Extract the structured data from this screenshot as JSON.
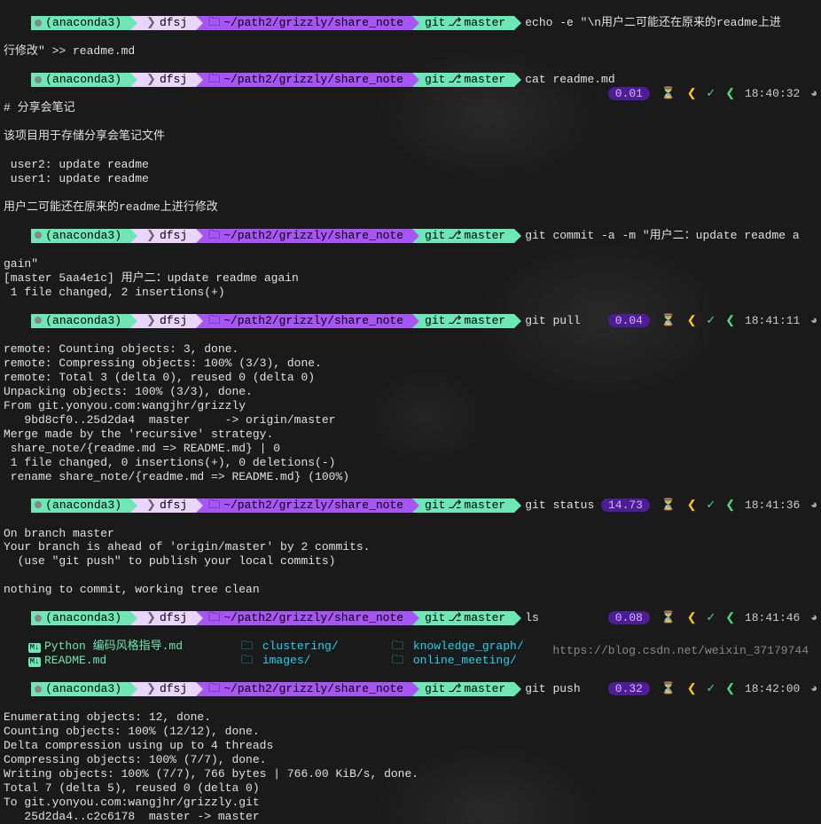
{
  "env": "(anaconda3)",
  "apple": "",
  "host": "dfsj",
  "folder_icon": "🗀",
  "path": "~/path2/grizzly/share_note",
  "branch_icon": "⎇",
  "git_label": "git",
  "branch": "master",
  "hourglass": "⏳",
  "check": "✓",
  "angleL": "❮",
  "angleR": "❯",
  "clock": "◕",
  "blocks": [
    {
      "cmd": "echo -e \"\\n用户二可能还在原来的readme上进",
      "cont": "行修改\" >> readme.md",
      "has_status": false
    },
    {
      "cmd": "cat readme.md",
      "dur": "0.01",
      "time": "18:40:32",
      "out": [
        "# 分享会笔记",
        "",
        "该项目用于存储分享会笔记文件",
        "",
        " user2: update readme",
        " user1: update readme",
        "",
        "用户二可能还在原来的readme上进行修改"
      ]
    },
    {
      "cmd": "git commit -a -m \"用户二：update readme a",
      "cont": "gain\"",
      "has_status": false,
      "out": [
        "[master 5aa4e1c] 用户二：update readme again",
        " 1 file changed, 2 insertions(+)"
      ]
    },
    {
      "cmd": "git pull",
      "dur": "0.04",
      "time": "18:41:11",
      "out": [
        "remote: Counting objects: 3, done.",
        "remote: Compressing objects: 100% (3/3), done.",
        "remote: Total 3 (delta 0), reused 0 (delta 0)",
        "Unpacking objects: 100% (3/3), done.",
        "From git.yonyou.com:wangjhr/grizzly",
        "   9bd8cf0..25d2da4  master     -> origin/master",
        "Merge made by the 'recursive' strategy.",
        " share_note/{readme.md => README.md} | 0",
        " 1 file changed, 0 insertions(+), 0 deletions(-)",
        " rename share_note/{readme.md => README.md} (100%)"
      ]
    },
    {
      "cmd": "git status",
      "dur": "14.73",
      "time": "18:41:36",
      "out": [
        "On branch master",
        "Your branch is ahead of 'origin/master' by 2 commits.",
        "  (use \"git push\" to publish your local commits)",
        "",
        "nothing to commit, working tree clean"
      ]
    },
    {
      "cmd": "ls",
      "dur": "0.08",
      "time": "18:41:46",
      "ls": {
        "row1": [
          {
            "type": "md",
            "name": "Python 编码风格指导.md"
          },
          {
            "type": "dir",
            "name": "clustering/"
          },
          {
            "type": "dir",
            "name": "knowledge_graph/"
          }
        ],
        "row2": [
          {
            "type": "md",
            "name": "README.md"
          },
          {
            "type": "dir",
            "name": "images/"
          },
          {
            "type": "dir",
            "name": "online_meeting/"
          }
        ]
      }
    },
    {
      "cmd": "git push",
      "dur": "0.32",
      "time": "18:42:00",
      "out": [
        "Enumerating objects: 12, done.",
        "Counting objects: 100% (12/12), done.",
        "Delta compression using up to 4 threads",
        "Compressing objects: 100% (7/7), done.",
        "Writing objects: 100% (7/7), 766 bytes | 766.00 KiB/s, done.",
        "Total 7 (delta 5), reused 0 (delta 0)",
        "To git.yonyou.com:wangjhr/grizzly.git",
        "   25d2da4..c2c6178  master -> master"
      ]
    }
  ],
  "watermark": "https://blog.csdn.net/weixin_37179744"
}
